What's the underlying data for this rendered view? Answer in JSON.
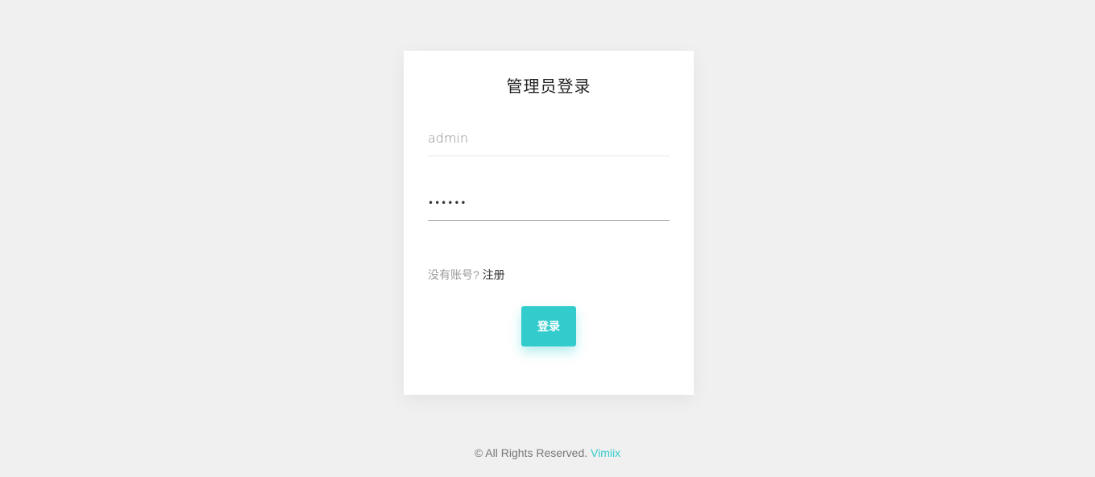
{
  "login": {
    "title": "管理员登录",
    "username": {
      "value": "",
      "placeholder": "admin"
    },
    "password": {
      "value": "••••••"
    },
    "register_prompt": "没有账号?",
    "register_link": "注册",
    "submit_label": "登录"
  },
  "footer": {
    "copyright": "© All Rights Reserved.",
    "brand": "Vimiix"
  },
  "colors": {
    "accent": "#33cccc",
    "background": "#f0f0f0",
    "card": "#ffffff"
  }
}
